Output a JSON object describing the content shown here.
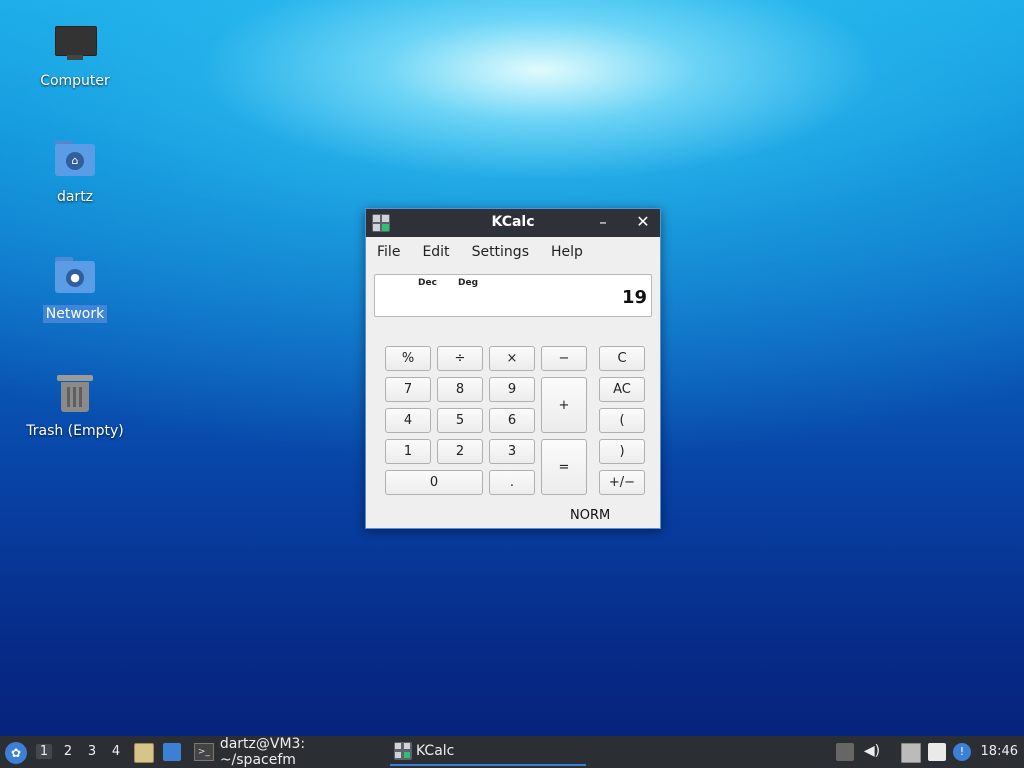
{
  "desktop": {
    "icons": [
      {
        "label": "Computer",
        "icon": "computer-icon"
      },
      {
        "label": "dartz",
        "icon": "home-folder-icon"
      },
      {
        "label": "Network",
        "icon": "network-folder-icon"
      },
      {
        "label": "Trash (Empty)",
        "icon": "trash-icon"
      }
    ]
  },
  "window": {
    "title": "KCalc",
    "minimize_glyph": "–",
    "close_glyph": "✕",
    "menu": [
      "File",
      "Edit",
      "Settings",
      "Help"
    ],
    "display": {
      "indicator_base": "Dec",
      "indicator_angle": "Deg",
      "value": "19"
    },
    "keys": {
      "percent": "%",
      "divide": "÷",
      "multiply": "×",
      "minus": "−",
      "clear": "C",
      "seven": "7",
      "eight": "8",
      "nine": "9",
      "plus": "+",
      "all_clear": "AC",
      "four": "4",
      "five": "5",
      "six": "6",
      "open_paren": "(",
      "one": "1",
      "two": "2",
      "three": "3",
      "equals": "=",
      "close_paren": ")",
      "zero": "0",
      "decimal": ".",
      "plus_minus": "+/−"
    },
    "status": "NORM"
  },
  "taskbar": {
    "workspaces": [
      "1",
      "2",
      "3",
      "4"
    ],
    "active_workspace": "1",
    "tasks": [
      {
        "label": "dartz@VM3: ~/spacefm",
        "icon": "terminal-icon"
      },
      {
        "label": "KCalc",
        "icon": "kcalc-icon"
      }
    ],
    "clock": "18:46"
  }
}
